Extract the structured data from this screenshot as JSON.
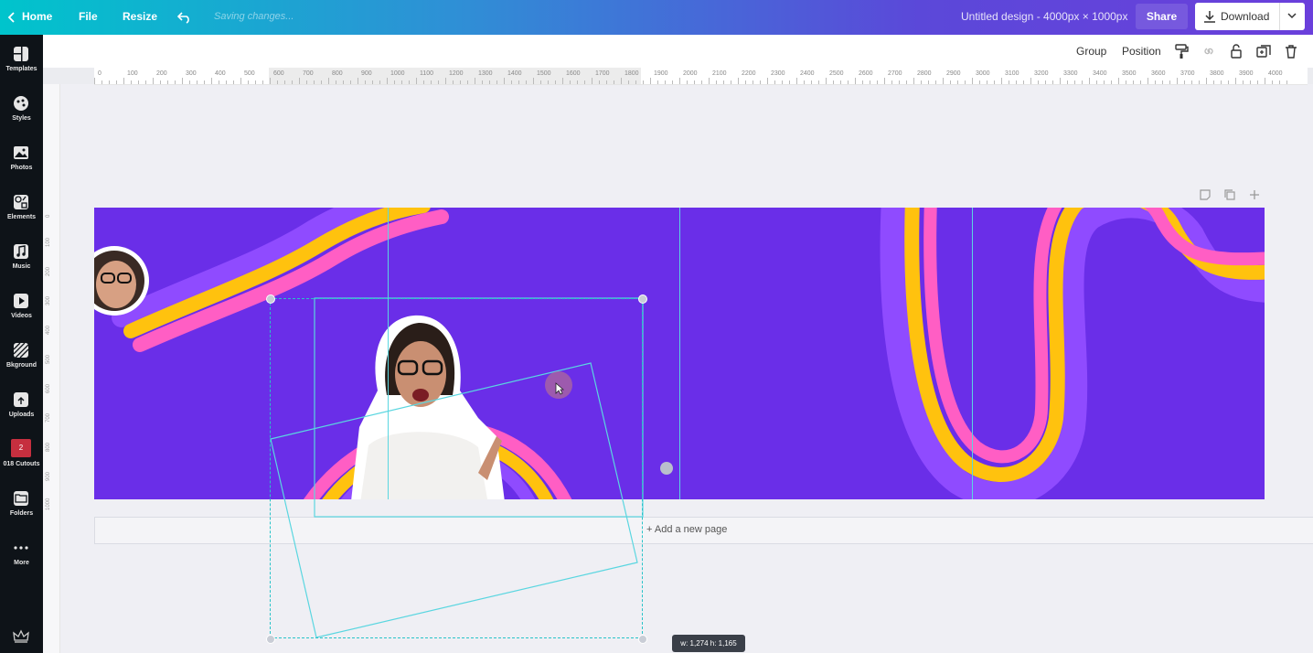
{
  "topbar": {
    "home_label": "Home",
    "file_label": "File",
    "resize_label": "Resize",
    "status": "Saving changes...",
    "design_title": "Untitled design - 4000px × 1000px",
    "share_label": "Share",
    "download_label": "Download",
    "icons": [
      "chevron-left-icon",
      "undo-icon",
      "download-icon",
      "chevron-down-icon"
    ]
  },
  "sidebar": {
    "items": [
      {
        "label": "Templates",
        "icon": "templates-icon"
      },
      {
        "label": "Styles",
        "icon": "palette-icon"
      },
      {
        "label": "Photos",
        "icon": "photo-icon"
      },
      {
        "label": "Elements",
        "icon": "shapes-icon"
      },
      {
        "label": "Music",
        "icon": "music-icon"
      },
      {
        "label": "Videos",
        "icon": "play-icon"
      },
      {
        "label": "Bkground",
        "icon": "background-icon"
      },
      {
        "label": "Uploads",
        "icon": "cloud-upload-icon"
      },
      {
        "label": "018 Cutouts",
        "icon": "folder-badge-icon",
        "badge": "2"
      },
      {
        "label": "Folders",
        "icon": "folder-icon"
      },
      {
        "label": "More",
        "icon": "more-icon"
      }
    ],
    "footer_icon": "crown-icon"
  },
  "toolbar": {
    "group_label": "Group",
    "position_label": "Position",
    "icons": [
      "paint-roller-icon",
      "link-icon",
      "lock-icon",
      "duplicate-icon",
      "trash-icon"
    ]
  },
  "ruler": {
    "ticks": [
      "0",
      "100",
      "200",
      "300",
      "400",
      "500",
      "600",
      "700",
      "800",
      "900",
      "1000",
      "1100",
      "1200",
      "1300",
      "1400",
      "1500",
      "1600",
      "1700",
      "1800",
      "1900",
      "2000",
      "2100",
      "2200",
      "2300",
      "2400",
      "2500",
      "2600",
      "2700",
      "2800",
      "2900",
      "3000",
      "3100",
      "3200",
      "3300",
      "3400",
      "3500",
      "3600",
      "3700",
      "3800",
      "3900",
      "4000"
    ],
    "vticks": [
      "0",
      "100",
      "200",
      "300",
      "400",
      "500",
      "600",
      "700",
      "800",
      "900",
      "1000"
    ]
  },
  "canvas": {
    "page_actions": [
      "notes-icon",
      "copy-page-icon",
      "add-icon"
    ],
    "add_page_label": "+ Add a new page",
    "dimensions": "w: 1,274 h: 1,165",
    "colors": {
      "background": "#6a2ee8",
      "stripe_purple": "#8f4bff",
      "stripe_pink": "#ff5ec4",
      "stripe_yellow": "#ffc20e",
      "selection": "#27c3c8"
    }
  }
}
